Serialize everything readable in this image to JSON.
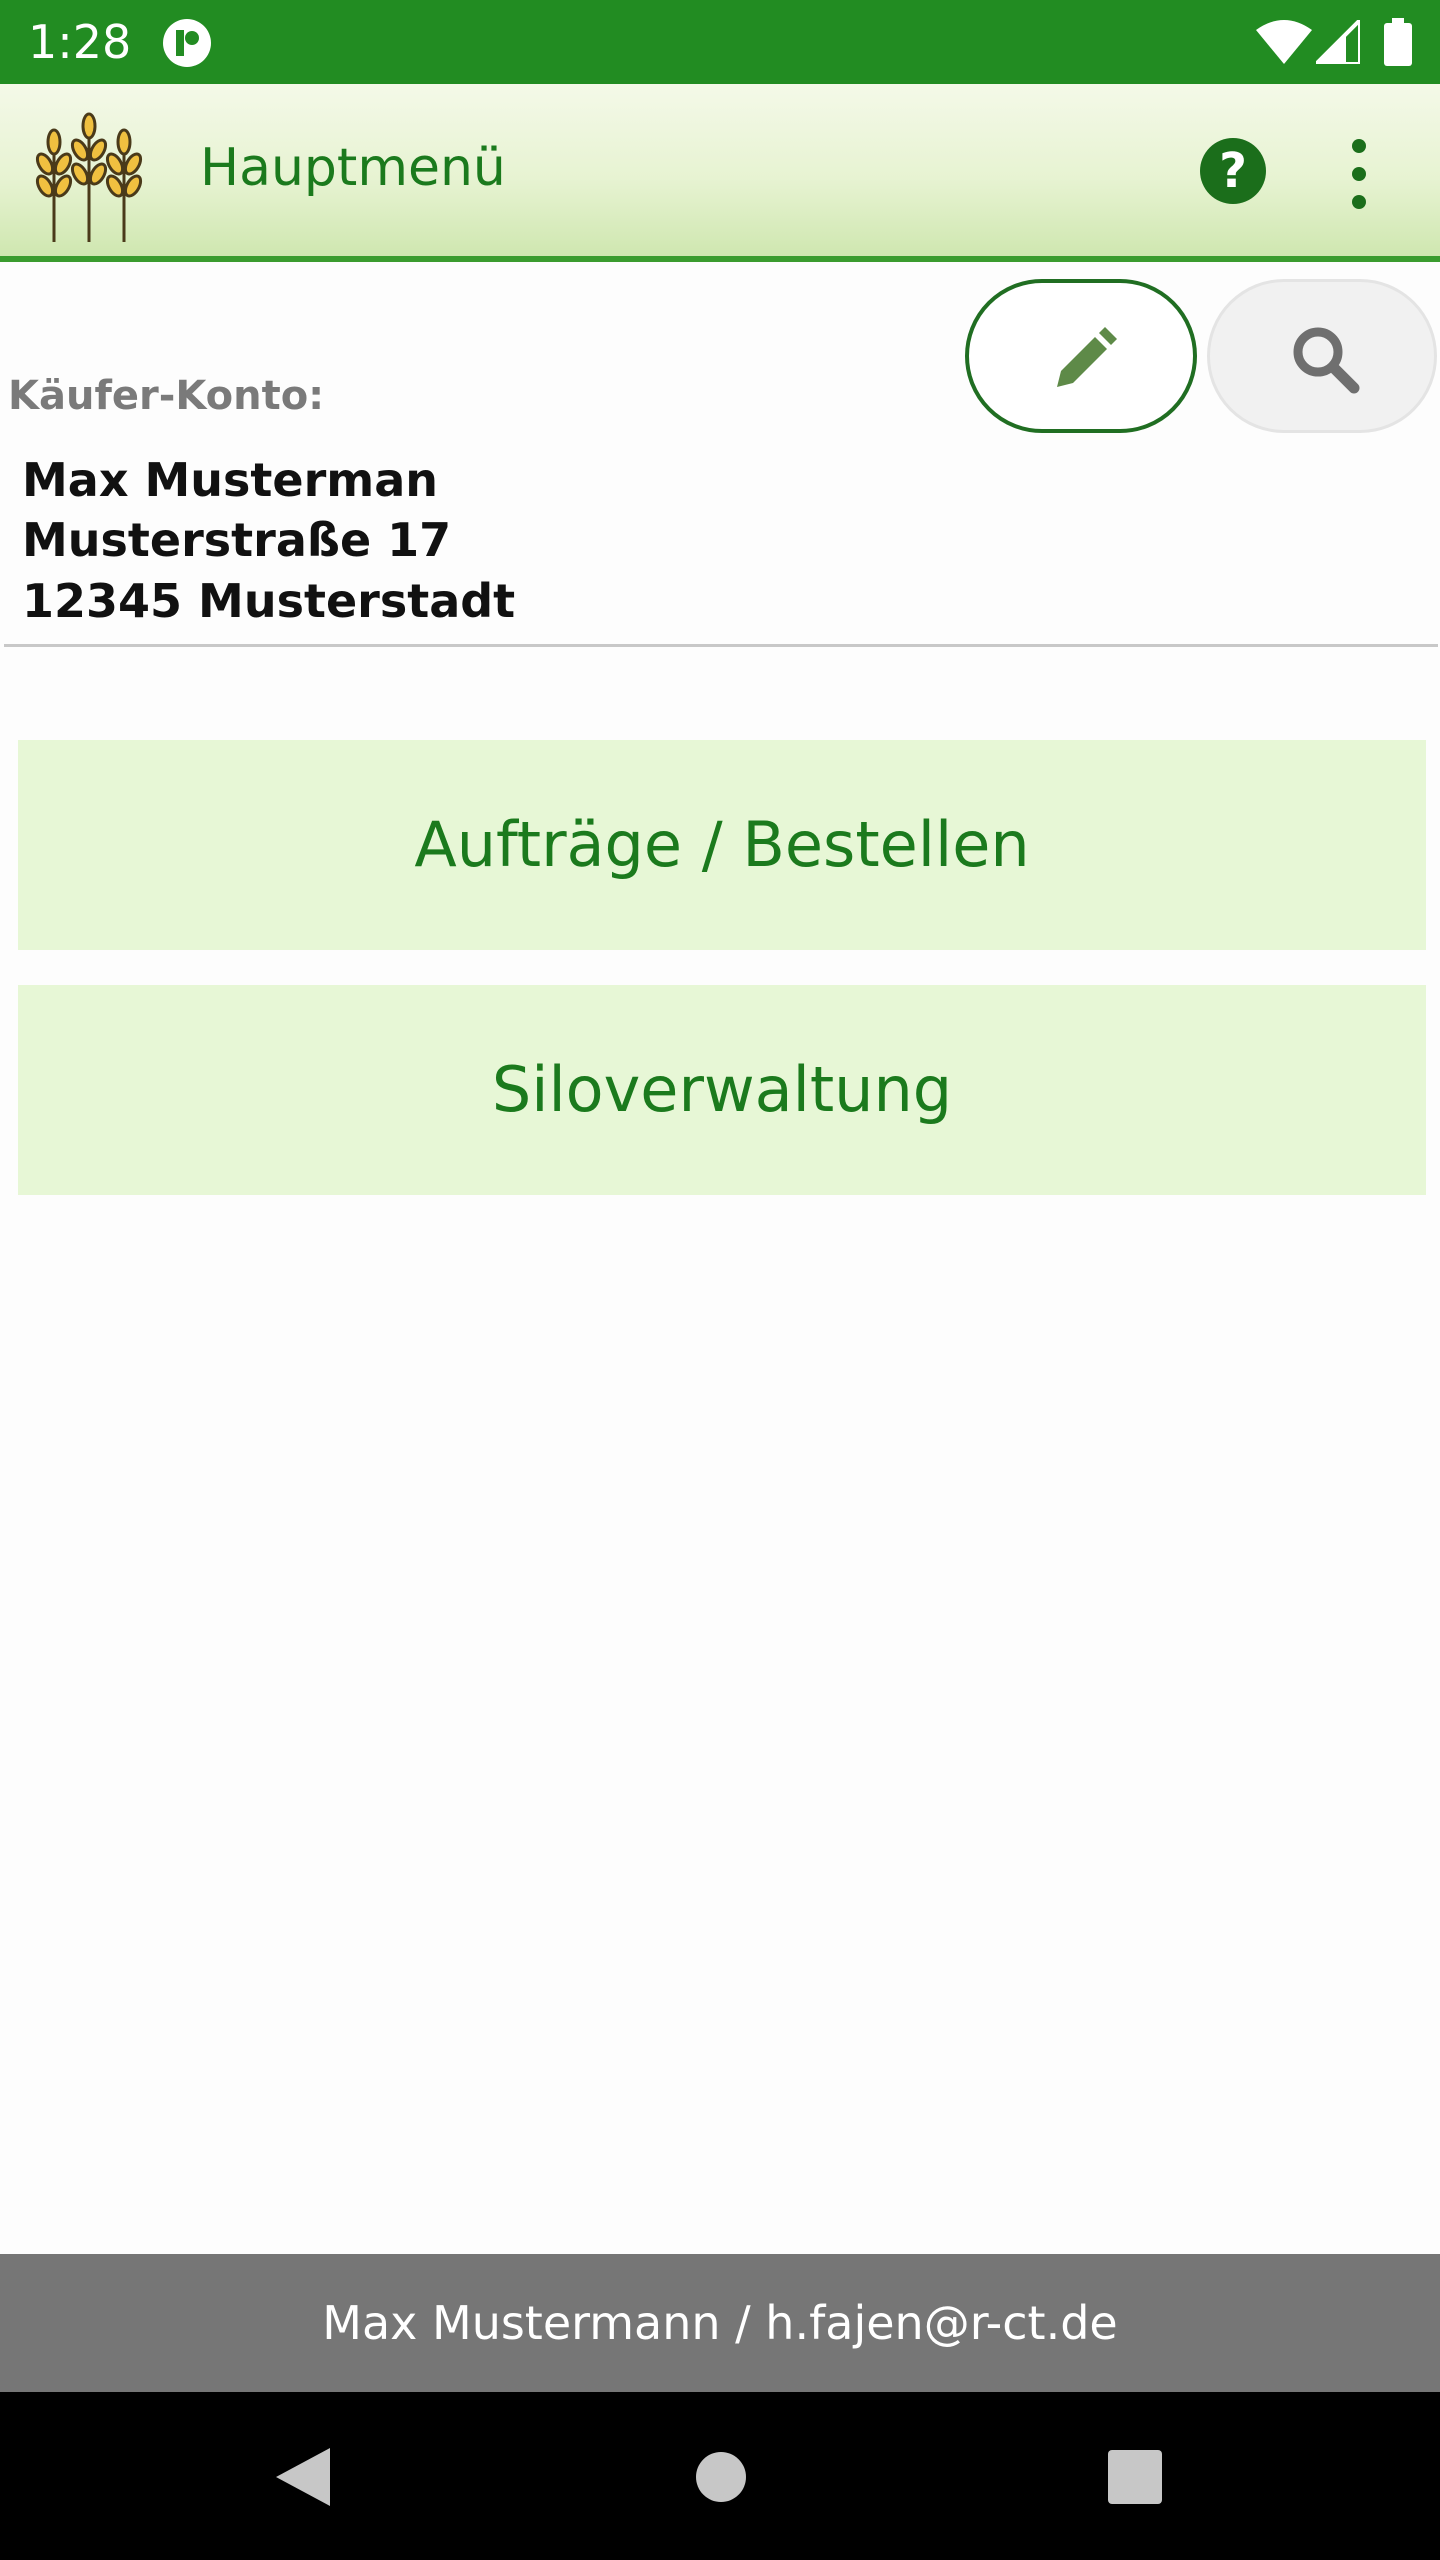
{
  "status_bar": {
    "time": "1:28",
    "icons": [
      "app-notification-icon",
      "wifi-icon",
      "signal-icon",
      "battery-icon"
    ]
  },
  "app_bar": {
    "title": "Hauptmenü",
    "logo_icon": "wheat-logo-icon",
    "help_label": "?",
    "actions": [
      "help-icon",
      "more-vert-icon"
    ]
  },
  "account": {
    "label": "Käufer-Konto:",
    "name": "Max Musterman",
    "street": "Musterstraße 17",
    "city": "12345 Musterstadt",
    "actions": [
      "edit-icon",
      "search-icon"
    ]
  },
  "menu": {
    "items": [
      {
        "label": "Aufträge / Bestellen"
      },
      {
        "label": "Siloverwaltung"
      }
    ]
  },
  "footer": {
    "user_info": "Max Mustermann / h.fajen@r-ct.de"
  },
  "navigation": {
    "icons": [
      "back-icon",
      "home-icon",
      "recents-icon"
    ]
  },
  "colors": {
    "status_bar": "#228c22",
    "primary_green": "#1b7a1d",
    "menu_button_bg": "#e7f7d6",
    "footer_bg": "#767676"
  }
}
